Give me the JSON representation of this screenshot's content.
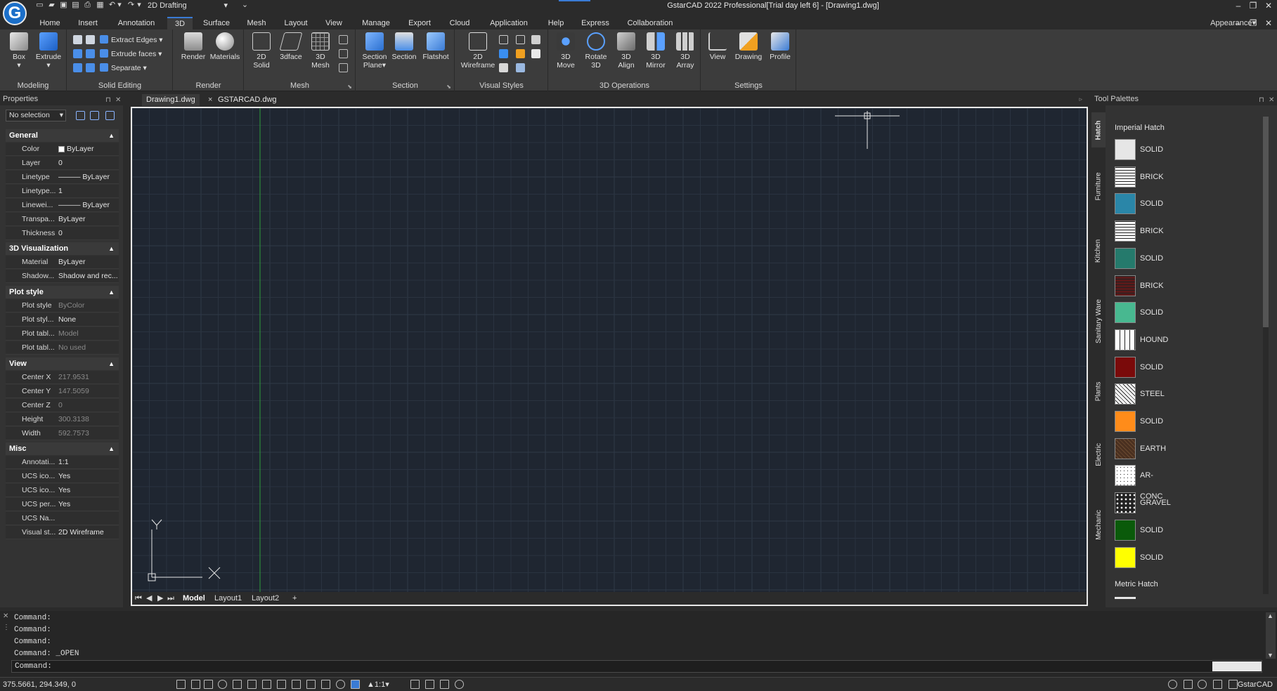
{
  "titlebar": {
    "title": "GstarCAD 2022 Professional[Trial day left 6] - [Drawing1.dwg]",
    "workspace": "2D Drafting",
    "logo": "G",
    "minimize": "–",
    "restore": "❐",
    "close": "✕"
  },
  "menu_tabs": [
    "Home",
    "Insert",
    "Annotation",
    "3D",
    "Surface",
    "Mesh",
    "Layout",
    "View",
    "Manage",
    "Export",
    "Cloud",
    "Application",
    "Help",
    "Express",
    "Collaboration"
  ],
  "active_tab": "3D",
  "appearance": "Appearance",
  "ribbon": {
    "modeling": {
      "title": "Modeling",
      "box": "Box",
      "extrude": "Extrude"
    },
    "solid_editing": {
      "title": "Solid Editing",
      "extract_edges": "Extract Edges",
      "extrude_faces": "Extrude faces",
      "separate": "Separate"
    },
    "render": {
      "title": "Render",
      "render": "Render",
      "materials": "Materials"
    },
    "mesh": {
      "title": "Mesh",
      "solid2d_1": "2D",
      "solid2d_2": "Solid",
      "face3d": "3dface",
      "mesh3d_1": "3D",
      "mesh3d_2": "Mesh"
    },
    "section": {
      "title": "Section",
      "plane_1": "Section",
      "plane_2": "Plane",
      "section": "Section",
      "flatshot": "Flatshot"
    },
    "visual_styles": {
      "title": "Visual Styles",
      "wire_1": "2D",
      "wire_2": "Wireframe"
    },
    "ops3d": {
      "title": "3D Operations",
      "move_1": "3D",
      "move_2": "Move",
      "rotate_1": "Rotate",
      "rotate_2": "3D",
      "align_1": "3D",
      "align_2": "Align",
      "mirror_1": "3D",
      "mirror_2": "Mirror",
      "array_1": "3D",
      "array_2": "Array"
    },
    "settings": {
      "title": "Settings",
      "view": "View",
      "drawing": "Drawing",
      "profile": "Profile"
    }
  },
  "properties": {
    "title": "Properties",
    "selection": "No selection",
    "sections": {
      "general": "General",
      "viz": "3D Visualization",
      "plot": "Plot style",
      "view": "View",
      "misc": "Misc"
    },
    "general": [
      {
        "k": "Color",
        "v": "ByLayer"
      },
      {
        "k": "Layer",
        "v": "0"
      },
      {
        "k": "Linetype",
        "v": "——— ByLayer"
      },
      {
        "k": "Linetype...",
        "v": "1"
      },
      {
        "k": "Linewei...",
        "v": "——— ByLayer"
      },
      {
        "k": "Transpa...",
        "v": "ByLayer"
      },
      {
        "k": "Thickness",
        "v": "0"
      }
    ],
    "viz": [
      {
        "k": "Material",
        "v": "ByLayer"
      },
      {
        "k": "Shadow...",
        "v": "Shadow and rec..."
      }
    ],
    "plot": [
      {
        "k": "Plot style",
        "v": "ByColor"
      },
      {
        "k": "Plot styl...",
        "v": "None"
      },
      {
        "k": "Plot tabl...",
        "v": "Model"
      },
      {
        "k": "Plot tabl...",
        "v": "No used"
      }
    ],
    "view": [
      {
        "k": "Center X",
        "v": "217.9531"
      },
      {
        "k": "Center Y",
        "v": "147.5059"
      },
      {
        "k": "Center Z",
        "v": "0"
      },
      {
        "k": "Height",
        "v": "300.3138"
      },
      {
        "k": "Width",
        "v": "592.7573"
      }
    ],
    "misc": [
      {
        "k": "Annotati...",
        "v": "1:1"
      },
      {
        "k": "UCS ico...",
        "v": "Yes"
      },
      {
        "k": "UCS ico...",
        "v": "Yes"
      },
      {
        "k": "UCS per...",
        "v": "Yes"
      },
      {
        "k": "UCS Na...",
        "v": ""
      },
      {
        "k": "Visual st...",
        "v": "2D Wireframe"
      }
    ]
  },
  "doc_tabs": [
    "Drawing1.dwg",
    "GSTARCAD.dwg"
  ],
  "doc_tab_close": "×",
  "layout_tabs": [
    "Model",
    "Layout1",
    "Layout2",
    "+"
  ],
  "ucs": {
    "x": "X",
    "y": "Y"
  },
  "tool_palettes": {
    "title": "Tool Palettes",
    "tabs": [
      "Hatch",
      "Furniture",
      "Kitchen",
      "Sanitary Ware",
      "Plants",
      "Electric",
      "Mechanic"
    ],
    "group1": "Imperial Hatch",
    "group2": "Metric Hatch",
    "items": [
      {
        "label": "SOLID",
        "color": "#e6e6e6",
        "pattern": "none"
      },
      {
        "label": "BRICK",
        "color": "#ffffff",
        "pattern": "brick"
      },
      {
        "label": "SOLID",
        "color": "#2a86a8",
        "pattern": "none"
      },
      {
        "label": "BRICK",
        "color": "#ffffff",
        "pattern": "brick"
      },
      {
        "label": "SOLID",
        "color": "#257a6c",
        "pattern": "none"
      },
      {
        "label": "BRICK",
        "color": "#5a1a1a",
        "pattern": "brick"
      },
      {
        "label": "SOLID",
        "color": "#48b890",
        "pattern": "none"
      },
      {
        "label": "HOUND",
        "color": "#ffffff",
        "pattern": "hound"
      },
      {
        "label": "SOLID",
        "color": "#7a0a0a",
        "pattern": "none"
      },
      {
        "label": "STEEL",
        "color": "#ffffff",
        "pattern": "steel"
      },
      {
        "label": "SOLID",
        "color": "#ff8c1a",
        "pattern": "none"
      },
      {
        "label": "EARTH",
        "color": "#4a3020",
        "pattern": "earth"
      },
      {
        "label": "AR-CONC",
        "color": "#ffffff",
        "pattern": "conc"
      },
      {
        "label": "GRAVEL",
        "color": "#ffffff",
        "pattern": "gravel"
      },
      {
        "label": "SOLID",
        "color": "#0a5a0a",
        "pattern": "none"
      },
      {
        "label": "SOLID",
        "color": "#ffff00",
        "pattern": "none"
      }
    ]
  },
  "command": {
    "lines": [
      "Command:",
      "Command:",
      "Command:",
      "Command: _OPEN"
    ],
    "prompt": "Command:"
  },
  "status": {
    "coords": "375.5661, 294.349, 0",
    "scale": "1:1",
    "brand": "GstarCAD"
  },
  "colors": {
    "accent": "#3a7bd5",
    "canvas": "#1f2631",
    "grid": "#2a3340",
    "ucs_line": "#2e9b3a"
  }
}
